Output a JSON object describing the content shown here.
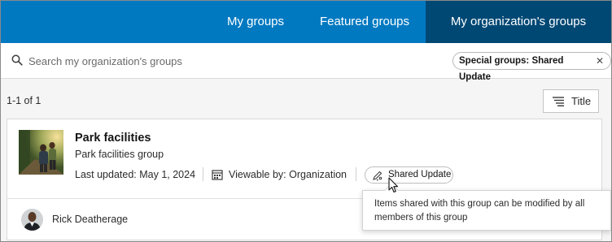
{
  "tabs": [
    {
      "label": "My groups",
      "active": false
    },
    {
      "label": "Featured groups",
      "active": false
    },
    {
      "label": "My organization's groups",
      "active": true
    }
  ],
  "colors": {
    "tabbar_bg": "#0079c1",
    "active_tab_bg": "#004874"
  },
  "search": {
    "placeholder": "Search my organization's groups",
    "value": ""
  },
  "filter_chip": {
    "label": "Special groups: Shared Update",
    "close_icon": "close-icon"
  },
  "results": {
    "count_label": "1-1 of 1",
    "sort_label": "Title",
    "sort_icon": "sort-lines-icon"
  },
  "group": {
    "title": "Park facilities",
    "subtitle": "Park facilities group",
    "last_updated": "Last updated: May 1, 2024",
    "viewable": "Viewable by: Organization",
    "shared_update_label": "Shared Update",
    "owner": "Rick Deatherage"
  },
  "tooltip": {
    "text": "Items shared with this group can be modified by all members of this group"
  }
}
